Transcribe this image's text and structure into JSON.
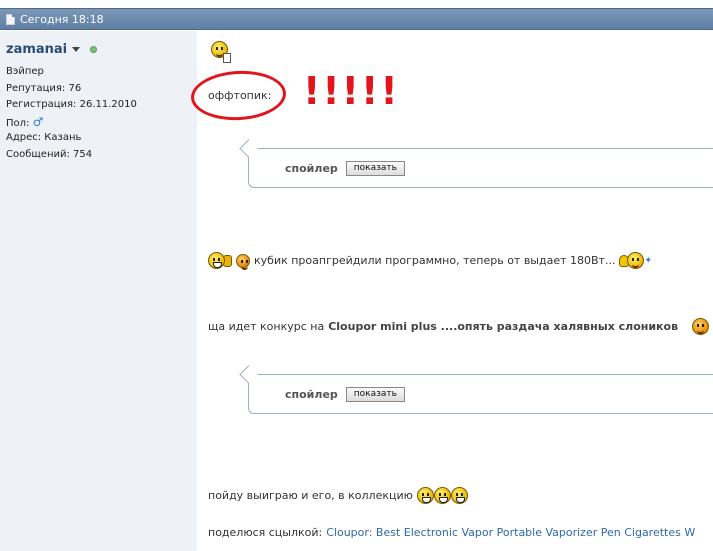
{
  "header": {
    "timestamp": "Сегодня 18:18"
  },
  "user": {
    "name": "zamanai",
    "rank": "Вэйпер",
    "reputation": "Репутация: 76",
    "registered": "Регистрация: 26.11.2010",
    "gender_label": "Пол:",
    "gender_icon": "♂",
    "address": "Адрес: Казань",
    "messages": "Сообщений: 754"
  },
  "post": {
    "offtopic": "оффтопик:",
    "exclaims": "!!!!!",
    "spoiler1": {
      "title": "спойлер",
      "button": "показать"
    },
    "line1": "кубик проапгрейдили программно, теперь от выдает 180Вт...",
    "line2_prefix": "ща идет конкурс на",
    "line2_bold": "Cloupor mini plus ....опять раздача халявных слоников",
    "spoiler2": {
      "title": "спойлер",
      "button": "показать"
    },
    "line3": "пойду выиграю и его, в коллекцию",
    "line4_prefix": "поделюся сцылкой:",
    "line4_link": "Cloupor: Best Electronic Vapor Portable Vaporizer Pen Cigarettes W"
  },
  "colors": {
    "header_bg": "#6d89ad",
    "sidebar_bg": "#eef1f5",
    "username": "#2a4d77",
    "annotation_red": "#e0161c",
    "link": "#2c6aa8"
  }
}
